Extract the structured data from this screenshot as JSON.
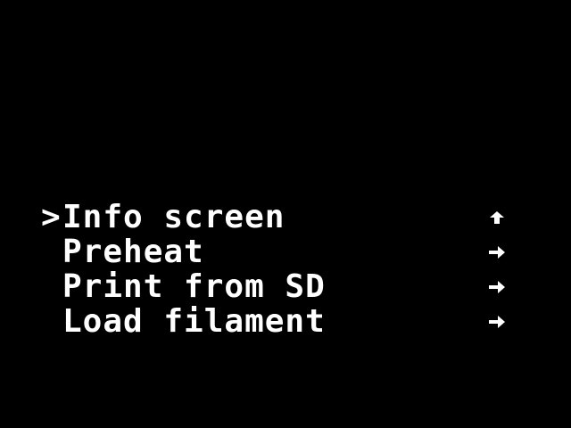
{
  "menu": {
    "cursor": ">",
    "selected_index": 0,
    "items": [
      {
        "label": "Info screen",
        "arrow_icon": "arrow-up-icon"
      },
      {
        "label": "Preheat",
        "arrow_icon": "arrow-right-icon"
      },
      {
        "label": "Print from SD",
        "arrow_icon": "arrow-right-icon"
      },
      {
        "label": "Load filament",
        "arrow_icon": "arrow-right-icon"
      }
    ]
  },
  "colors": {
    "background": "#000000",
    "foreground": "#ffffff"
  }
}
